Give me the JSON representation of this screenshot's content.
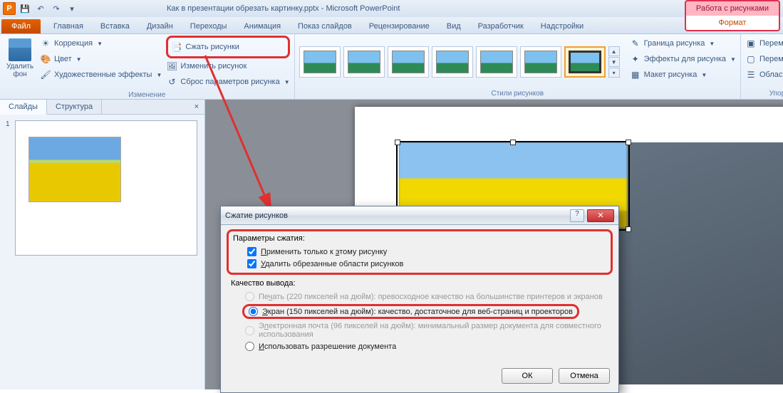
{
  "title": "Как в презентации обрезать картинку.pptx - Microsoft PowerPoint",
  "context_title": "Работа с рисунками",
  "context_tab": "Формат",
  "tabs": {
    "file": "Файл",
    "home": "Главная",
    "insert": "Вставка",
    "design": "Дизайн",
    "transitions": "Переходы",
    "animations": "Анимация",
    "slideshow": "Показ слайдов",
    "review": "Рецензирование",
    "view": "Вид",
    "developer": "Разработчик",
    "addins": "Надстройки"
  },
  "ribbon": {
    "remove_bg": "Удалить фон",
    "corrections": "Коррекция",
    "color": "Цвет",
    "artistic": "Художественные эффекты",
    "compress": "Сжать рисунки",
    "change": "Изменить рисунок",
    "reset": "Сброс параметров рисунка",
    "group_adjust": "Изменение",
    "group_styles": "Стили рисунков",
    "border": "Граница рисунка",
    "effects": "Эффекты для рисунка",
    "layout": "Макет рисунка",
    "forward": "Переместить вперед",
    "backward": "Переместить назад",
    "selection": "Область выделения",
    "group_arrange": "Упорядочить"
  },
  "side": {
    "slides": "Слайды",
    "outline": "Структура",
    "num": "1"
  },
  "dialog": {
    "title": "Сжатие рисунков",
    "sec1": "Параметры сжатия:",
    "opt_apply": "Применить только к этому рисунку",
    "opt_delete": "Удалить обрезанные области рисунков",
    "sec2": "Качество вывода:",
    "q_print": "Печать (220 пикселей на дюйм): превосходное качество на большинстве принтеров и экранов",
    "q_screen": "Экран (150 пикселей на дюйм): качество, достаточное для веб-страниц и проекторов",
    "q_email": "Электронная почта (96 пикселей на дюйм): минимальный размер документа для совместного использования",
    "q_doc": "Использовать разрешение документа",
    "ok": "ОК",
    "cancel": "Отмена",
    "kp": "П",
    "ke": "э",
    "ku": "У",
    "kch": "ч",
    "kek": "Э",
    "kel": "л",
    "kis": "И"
  }
}
